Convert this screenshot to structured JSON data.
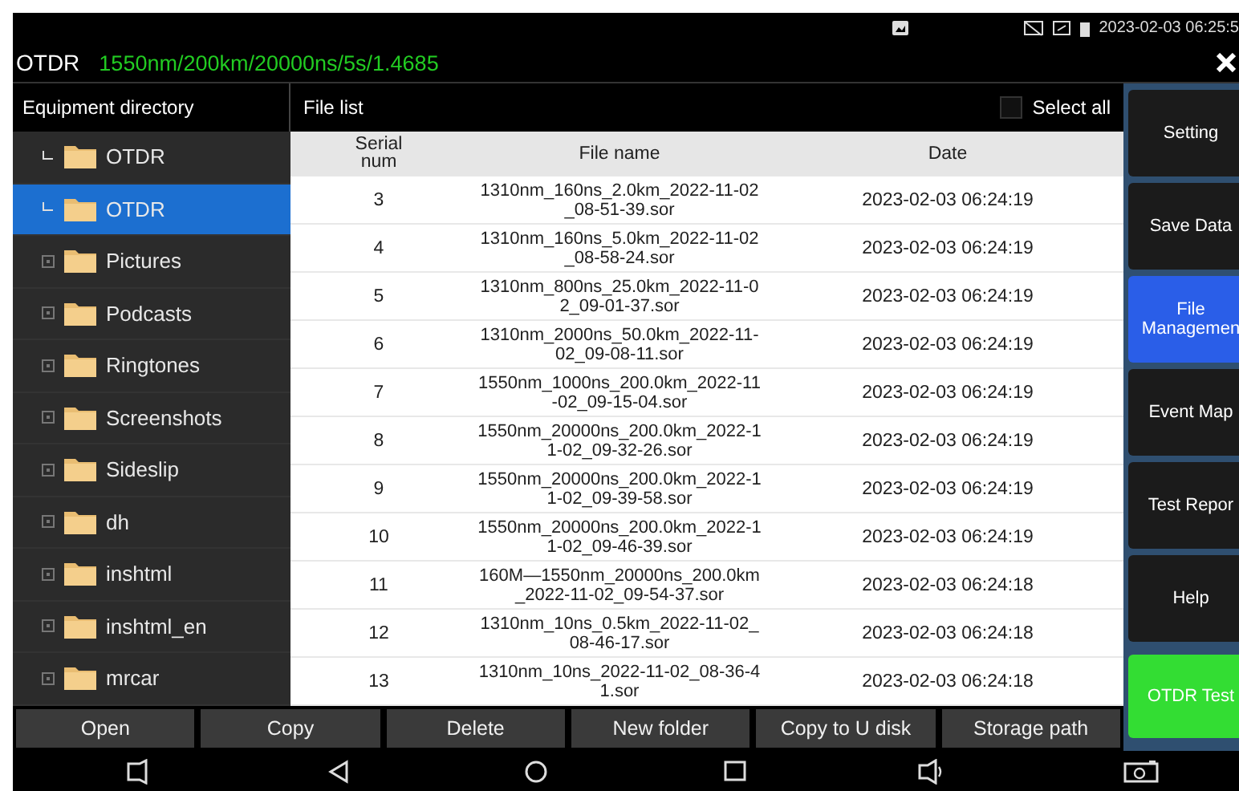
{
  "status_bar": {
    "time": "2023-02-03 06:25:5"
  },
  "title_bar": {
    "app": "OTDR",
    "params": "1550nm/200km/20000ns/5s/1.4685"
  },
  "directory": {
    "title": "Equipment directory",
    "items": [
      {
        "label": "OTDR",
        "expanded": true,
        "selected": false
      },
      {
        "label": "OTDR",
        "expanded": true,
        "selected": true
      },
      {
        "label": "Pictures",
        "expanded": false,
        "selected": false
      },
      {
        "label": "Podcasts",
        "expanded": false,
        "selected": false
      },
      {
        "label": "Ringtones",
        "expanded": false,
        "selected": false
      },
      {
        "label": "Screenshots",
        "expanded": false,
        "selected": false
      },
      {
        "label": "Sideslip",
        "expanded": false,
        "selected": false
      },
      {
        "label": "dh",
        "expanded": false,
        "selected": false
      },
      {
        "label": "inshtml",
        "expanded": false,
        "selected": false
      },
      {
        "label": "inshtml_en",
        "expanded": false,
        "selected": false
      },
      {
        "label": "mrcar",
        "expanded": false,
        "selected": false
      }
    ]
  },
  "file_list": {
    "title": "File list",
    "select_all": {
      "label": "Select all",
      "checked": false
    },
    "columns": [
      "Serial num",
      "File name",
      "Date"
    ],
    "rows": [
      {
        "serial": "3",
        "name": "1310nm_160ns_2.0km_2022-11-02_08-51-39.sor",
        "date": "2023-02-03 06:24:19"
      },
      {
        "serial": "4",
        "name": "1310nm_160ns_5.0km_2022-11-02_08-58-24.sor",
        "date": "2023-02-03 06:24:19"
      },
      {
        "serial": "5",
        "name": "1310nm_800ns_25.0km_2022-11-02_09-01-37.sor",
        "date": "2023-02-03 06:24:19"
      },
      {
        "serial": "6",
        "name": "1310nm_2000ns_50.0km_2022-11-02_09-08-11.sor",
        "date": "2023-02-03 06:24:19"
      },
      {
        "serial": "7",
        "name": "1550nm_1000ns_200.0km_2022-11-02_09-15-04.sor",
        "date": "2023-02-03 06:24:19"
      },
      {
        "serial": "8",
        "name": "1550nm_20000ns_200.0km_2022-11-02_09-32-26.sor",
        "date": "2023-02-03 06:24:19"
      },
      {
        "serial": "9",
        "name": "1550nm_20000ns_200.0km_2022-11-02_09-39-58.sor",
        "date": "2023-02-03 06:24:19"
      },
      {
        "serial": "10",
        "name": "1550nm_20000ns_200.0km_2022-11-02_09-46-39.sor",
        "date": "2023-02-03 06:24:19"
      },
      {
        "serial": "11",
        "name": "160M—1550nm_20000ns_200.0km_2022-11-02_09-54-37.sor",
        "date": "2023-02-03 06:24:18"
      },
      {
        "serial": "12",
        "name": "1310nm_10ns_0.5km_2022-11-02_08-46-17.sor",
        "date": "2023-02-03 06:24:18"
      },
      {
        "serial": "13",
        "name": "1310nm_10ns_2022-11-02_08-36-41.sor",
        "date": "2023-02-03 06:24:18"
      }
    ]
  },
  "actions": [
    "Open",
    "Copy",
    "Delete",
    "New folder",
    "Copy to U disk",
    "Storage path"
  ],
  "side_menu": [
    {
      "label": "Setting",
      "kind": "nav",
      "selected": false
    },
    {
      "label": "Save Data",
      "kind": "nav",
      "selected": false
    },
    {
      "label": "File Managemen",
      "kind": "nav",
      "selected": true
    },
    {
      "label": "Event Map",
      "kind": "nav",
      "selected": false
    },
    {
      "label": "Test Repor",
      "kind": "nav",
      "selected": false
    },
    {
      "label": "Help",
      "kind": "nav",
      "selected": false
    },
    {
      "label": "OTDR Test",
      "kind": "action",
      "selected": false
    }
  ]
}
